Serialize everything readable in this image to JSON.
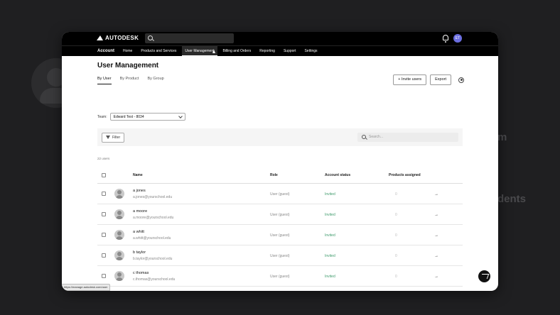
{
  "window": {
    "brand": "AUTODESK",
    "profile_initials": "ET"
  },
  "nav": {
    "brand": "Account",
    "items": [
      "Home",
      "Products and Services",
      "User Management",
      "Billing and Orders",
      "Reporting",
      "Support",
      "Settings"
    ],
    "active_index": 2
  },
  "page": {
    "title": "User Management",
    "tabs": [
      "By User",
      "By Product",
      "By Group"
    ],
    "active_tab": 0
  },
  "actions": {
    "invite_label": "Invite users",
    "export_label": "Export"
  },
  "team": {
    "label": "Team:",
    "value": "Edward Test - 8034"
  },
  "filter": {
    "button_label": "Filter",
    "search_placeholder": "Search..."
  },
  "user_count": "22 users",
  "table": {
    "headers": [
      "Name",
      "Role",
      "Account status",
      "Products assigned"
    ],
    "rows": [
      {
        "name": "a jones",
        "email": "a.jones@yourschool.edu",
        "role": "User (guest)",
        "status": "Invited",
        "products": "0"
      },
      {
        "name": "a moore",
        "email": "a.moore@yourschool.edu",
        "role": "User (guest)",
        "status": "Invited",
        "products": "0"
      },
      {
        "name": "a whitt",
        "email": "a.whitt@yourschool.edu",
        "role": "User (guest)",
        "status": "Invited",
        "products": "0"
      },
      {
        "name": "b taylor",
        "email": "b.taylor@yourschool.edu",
        "role": "User (guest)",
        "status": "Invited",
        "products": "0"
      },
      {
        "name": "c thomas",
        "email": "c.thomas@yourschool.edu",
        "role": "User (guest)",
        "status": "Invited",
        "products": "0"
      }
    ]
  },
  "statusbar_url": "https://manage.autodesk.com/user",
  "background": {
    "text1": "m",
    "text2": "dents"
  },
  "colors": {
    "status_invited": "#3e9a6b",
    "topbar": "#000000",
    "backdrop": "#1f1f21"
  }
}
